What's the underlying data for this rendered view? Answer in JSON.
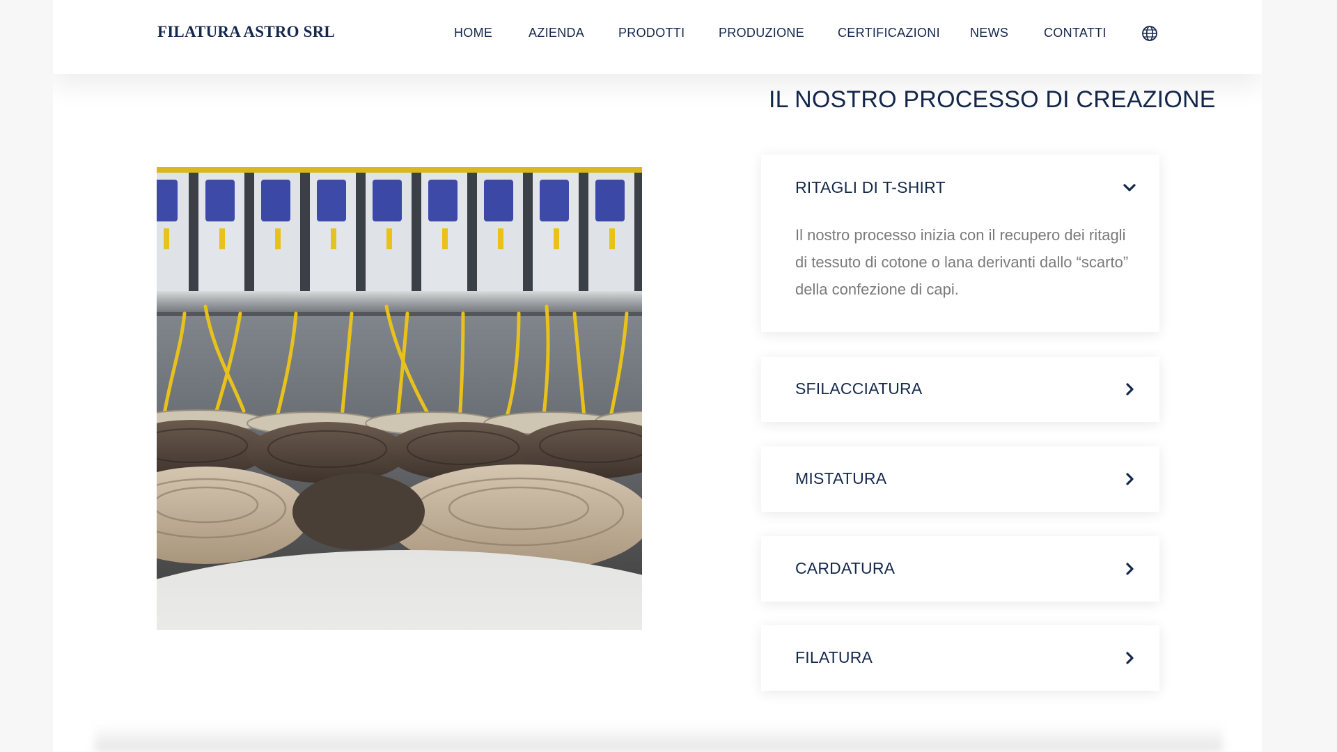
{
  "header": {
    "logo": "FILATURA ASTRO SRL",
    "nav": [
      "HOME",
      "AZIENDA",
      "PRODOTTI",
      "PRODUZIONE",
      "CERTIFICAZIONI",
      "NEWS",
      "CONTATTI"
    ],
    "language_icon": "globe-icon"
  },
  "section": {
    "title": "IL NOSTRO PROCESSO DI CREAZIONE",
    "image_subject": "textile spinning machinery with yellow yarn and coiled fibre bundles"
  },
  "accordion": [
    {
      "title": "RITAGLI DI T-SHIRT",
      "expanded": true,
      "icon": "chevron-down-icon",
      "body": "Il nostro processo inizia con il recupero dei ritagli di tessuto di cotone o lana derivanti dallo “scarto” della confezione di capi."
    },
    {
      "title": "SFILACCIATURA",
      "expanded": false,
      "icon": "chevron-right-icon"
    },
    {
      "title": "MISTATURA",
      "expanded": false,
      "icon": "chevron-right-icon"
    },
    {
      "title": "CARDATURA",
      "expanded": false,
      "icon": "chevron-right-icon"
    },
    {
      "title": "FILATURA",
      "expanded": false,
      "icon": "chevron-right-icon"
    }
  ],
  "colors": {
    "brand_navy": "#14284b",
    "body_text": "#7a7a7a",
    "page_background": "#f7f7f7",
    "yarn_yellow": "#e8c21b",
    "machine_blue": "#3d4aa8"
  }
}
